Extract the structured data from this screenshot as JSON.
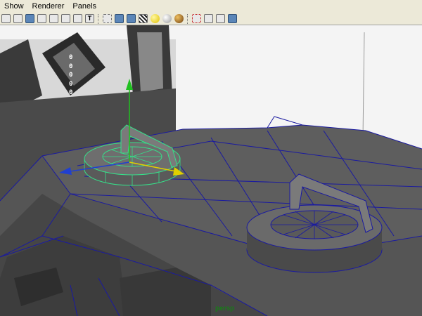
{
  "menu": {
    "items": [
      {
        "label": "Show"
      },
      {
        "label": "Renderer"
      },
      {
        "label": "Panels"
      }
    ]
  },
  "toolbar": {
    "icons": [
      "select-camera-icon",
      "camera-attributes-icon",
      "bookmarks-icon",
      "image-plane-icon",
      "grid-icon",
      "film-gate-icon",
      "resolution-gate-icon",
      "text-icon",
      "wireframe-icon",
      "smooth-shade-icon",
      "textured-icon",
      "default-light-icon",
      "all-lights-icon",
      "shadows-icon",
      "isolate-select-icon",
      "xray-icon",
      "xray-joints-icon",
      "high-quality-icon"
    ]
  },
  "viewport": {
    "camera_label": "persp",
    "readout": [
      "0",
      "0",
      "0",
      "0",
      "0"
    ]
  },
  "colors": {
    "menu_bg": "#ece9d8",
    "wireframe": "#1a1aa0",
    "selection": "#36e08a",
    "mesh_top": "#5a5a5a",
    "mesh_side": "#3c3c3c",
    "manip_y": "#20c020",
    "manip_x": "#e0d000",
    "manip_z": "#2040d0"
  }
}
